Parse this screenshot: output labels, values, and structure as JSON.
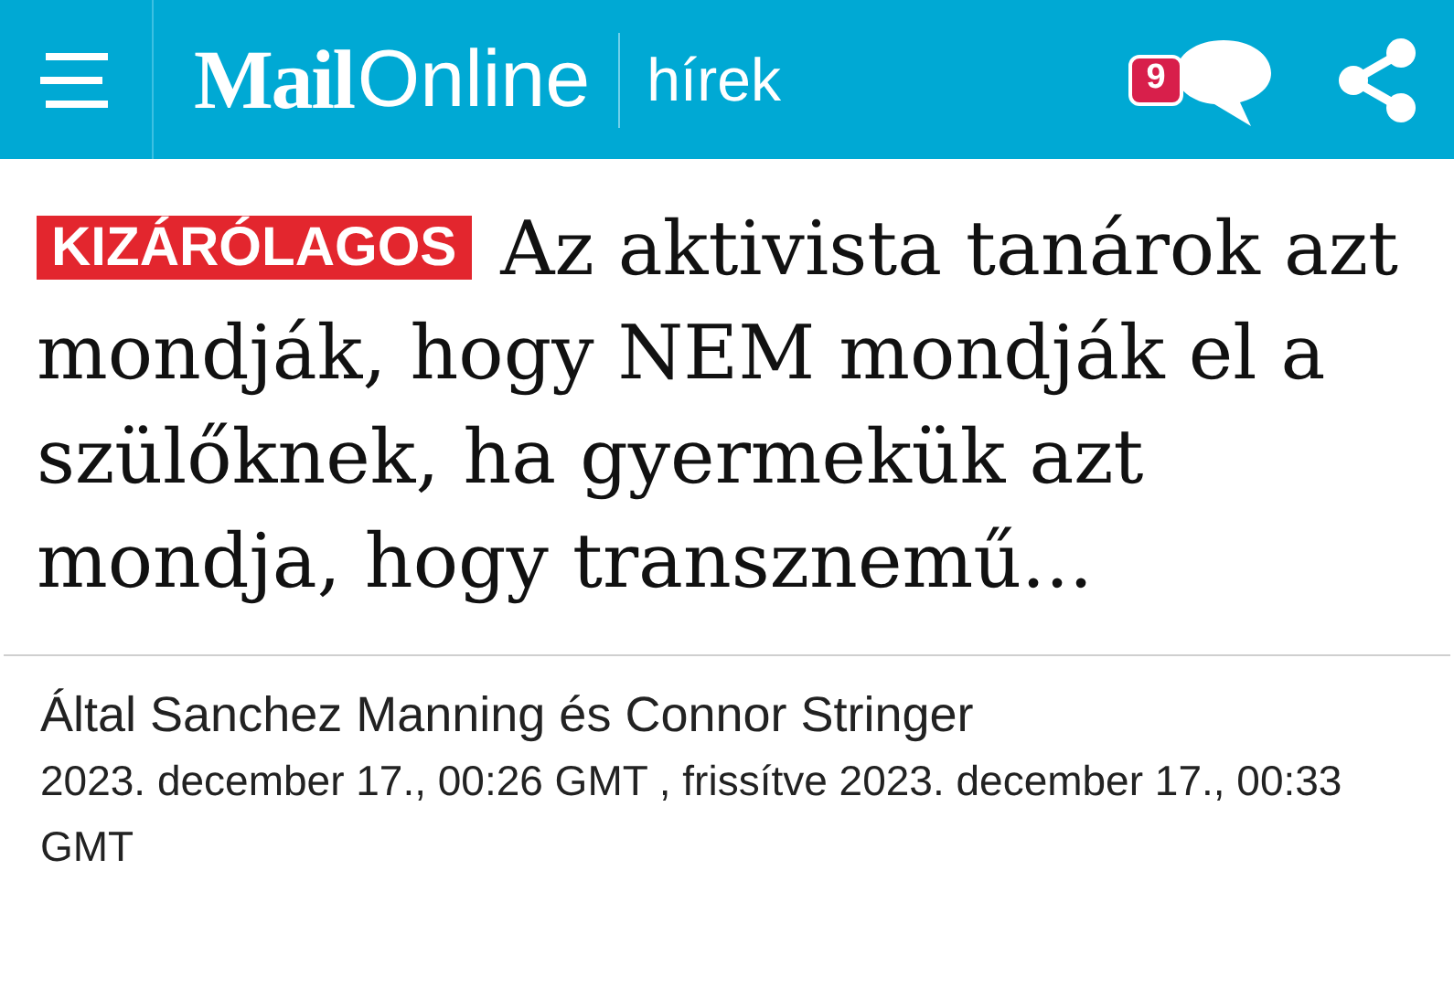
{
  "header": {
    "logo_part_1": "Mail",
    "logo_part_2": "Online",
    "section": "hírek",
    "comment_count": "9"
  },
  "article": {
    "badge": "KIZÁRÓLAGOS",
    "headline": "Az aktivista tanárok azt mondják, hogy NEM mondják el a szülőknek, ha gyermekük azt mondja, hogy transznemű...",
    "byline": "Által Sanchez Manning és Connor Stringer",
    "dateline": "2023. december 17., 00:26 GMT , frissítve 2023. december 17., 00:33 GMT"
  }
}
